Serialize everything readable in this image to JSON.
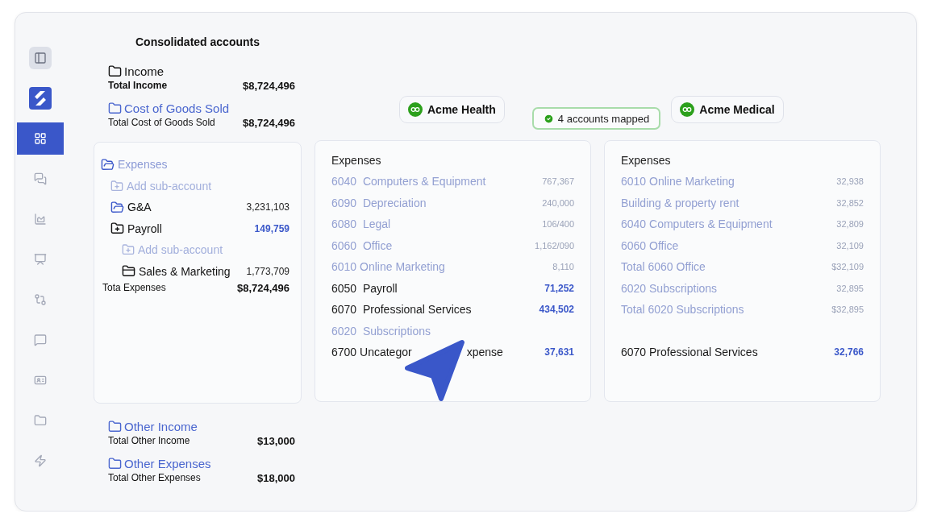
{
  "sidebar": {
    "items": [
      {
        "selected": false
      },
      {
        "selected": false
      },
      {
        "selected": true
      },
      {
        "selected": false
      },
      {
        "selected": false
      },
      {
        "selected": false
      },
      {
        "selected": false
      },
      {
        "selected": false
      },
      {
        "selected": false
      },
      {
        "selected": false
      },
      {
        "selected": false
      }
    ]
  },
  "consolidated": {
    "title": "Consolidated accounts",
    "before": [
      {
        "kind": "primary",
        "label": "Income",
        "total_label": "Total Income",
        "total": "$8,724,496"
      },
      {
        "kind": "link",
        "label": "Cost of Goods Sold",
        "total_label": "Total Cost of Goods Sold",
        "total": "$8,724,496"
      }
    ],
    "expenses": {
      "label": "Expenses",
      "items": [
        {
          "kind": "add",
          "label": "Add sub-account"
        },
        {
          "kind": "folder",
          "label": "G&A",
          "value": "3,231,103",
          "highlighted": false
        },
        {
          "kind": "folder-add",
          "label": "Payroll",
          "value": "149,759",
          "highlighted": true,
          "children": [
            {
              "kind": "add",
              "label": "Add sub-account"
            },
            {
              "kind": "folder-closed",
              "label": "Sales & Marketing",
              "value": "1,773,709",
              "highlighted": false
            }
          ]
        }
      ],
      "total_label": "Tota Expenses",
      "total": "$8,724,496"
    },
    "after": [
      {
        "kind": "link",
        "label": "Other Income",
        "total_label": "Total Other Income",
        "total": "$13,000"
      },
      {
        "kind": "link",
        "label": "Other Expenses",
        "total_label": "Total Other Expenses",
        "total": "$18,000"
      }
    ]
  },
  "mapped_badge": "4 accounts mapped",
  "panels": [
    {
      "company": "Acme Health",
      "title": "Expenses",
      "rows": [
        {
          "kind": "mapped",
          "label": "6040  Computers & Equipment",
          "value": "767,367"
        },
        {
          "kind": "mapped",
          "label": "6090  Depreciation",
          "value": "240,000"
        },
        {
          "kind": "mapped",
          "label": "6080  Legal",
          "value": "106/400"
        },
        {
          "kind": "mapped",
          "label": "6060  Office",
          "value": "1,162/090"
        },
        {
          "kind": "mapped",
          "label": "6010 Online Marketing",
          "value": "8,110"
        },
        {
          "kind": "unmapped",
          "label": "6050  Payroll",
          "value": "71,252"
        },
        {
          "kind": "unmapped",
          "label": "6070  Professional Services",
          "value": "434,502"
        },
        {
          "kind": "mapped",
          "label": "6020  Subscriptions"
        },
        {
          "kind": "unmapped",
          "label": "6700 Uncategor",
          "label_end": "xpense",
          "value": "37,631"
        }
      ]
    },
    {
      "company": "Acme Medical",
      "title": "Expenses",
      "rows": [
        {
          "kind": "mapped",
          "label": "6010 Online Marketing",
          "value": "32,938"
        },
        {
          "kind": "mapped",
          "label": "Building & property rent",
          "value": "32,852"
        },
        {
          "kind": "mapped",
          "label": "6040 Computers & Equipment",
          "value": "32,809"
        },
        {
          "kind": "mapped",
          "label": "6060 Office",
          "value": "32,109"
        },
        {
          "kind": "mapped",
          "label": "Total 6060 Office",
          "value": "$32,109"
        },
        {
          "kind": "mapped",
          "label": "6020 Subscriptions",
          "value": "32,895"
        },
        {
          "kind": "mapped",
          "label": "Total 6020 Subscriptions",
          "value": "$32,895"
        },
        {
          "kind": "unmapped",
          "label": "6070 Professional Services",
          "value": "32,766"
        }
      ]
    }
  ]
}
